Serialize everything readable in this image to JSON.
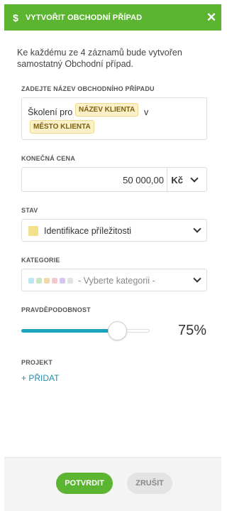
{
  "dialog": {
    "title": "VYTVOŘIT OBCHODNÍ PŘÍPAD",
    "icon": "dollar-icon",
    "header_color": "#5cb531"
  },
  "intro_text": "Ke každému ze 4 záznamů bude vytvořen samostatný Obchodní případ.",
  "name_section": {
    "label": "ZADEJTE NÁZEV OBCHODNÍHO PŘÍPADU",
    "prefix": "Školení pro",
    "tag1": "NÁZEV KLIENTA",
    "middle": "v",
    "tag2": "MĚSTO KLIENTA"
  },
  "price": {
    "label": "KONEČNÁ CENA",
    "value": "50 000,00",
    "currency": "Kč"
  },
  "status": {
    "label": "STAV",
    "value": "Identifikace příležitosti",
    "swatch_color": "#f3e08b"
  },
  "category": {
    "label": "KATEGORIE",
    "placeholder": "- Vyberte kategorii -",
    "dot_colors": [
      "#bfe5f5",
      "#c5e8c3",
      "#f6d7a8",
      "#f5c6cc",
      "#d6c5f0",
      "#e2e2e2"
    ]
  },
  "probability": {
    "label": "PRAVDĚPODOBNOST",
    "value": 0.75,
    "display": "75%"
  },
  "project": {
    "label": "PROJEKT",
    "add_label": "+ PŘIDAT"
  },
  "footer": {
    "confirm_label": "POTVRDIT",
    "cancel_label": "ZRUŠIT"
  }
}
